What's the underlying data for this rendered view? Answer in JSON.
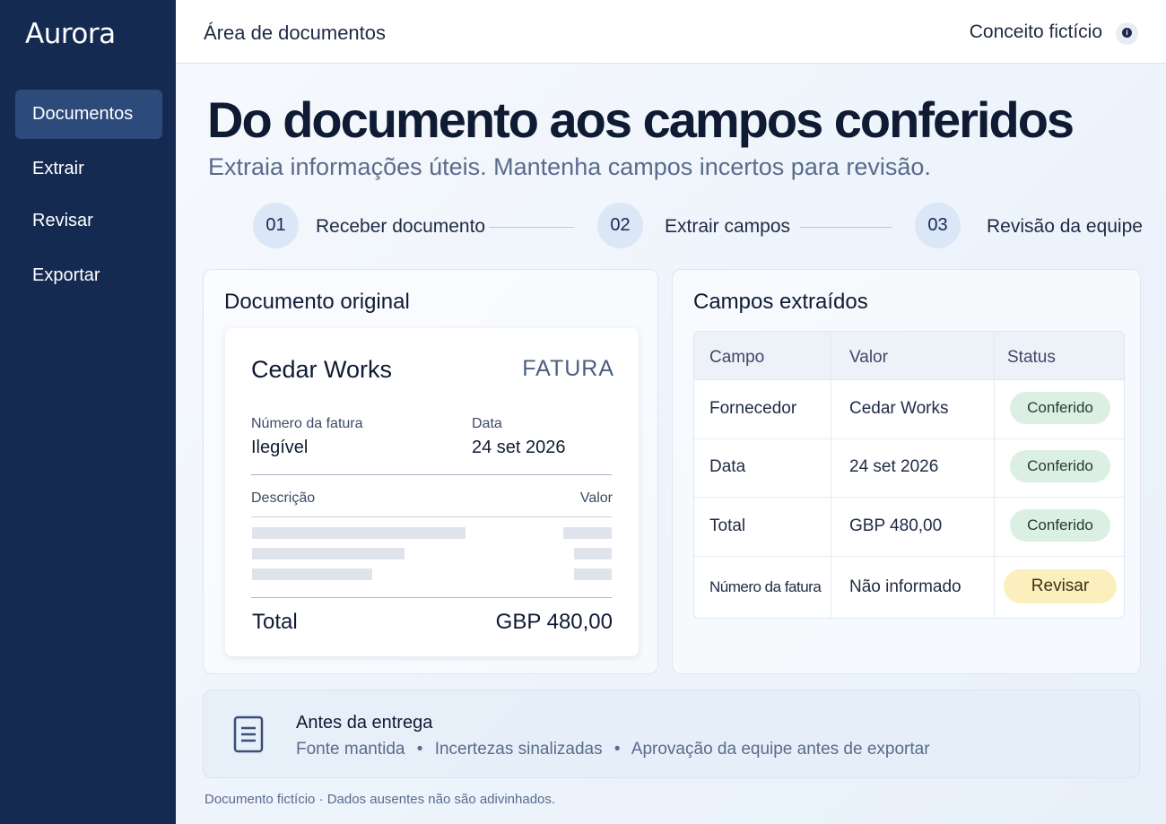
{
  "sidebar": {
    "brand": "Aurora",
    "items": [
      {
        "label": "Documentos",
        "active": true
      },
      {
        "label": "Extrair",
        "active": false
      },
      {
        "label": "Revisar",
        "active": false
      },
      {
        "label": "Exportar",
        "active": false
      }
    ]
  },
  "topbar": {
    "title": "Área de documentos",
    "concept_label": "Conceito fictício",
    "info_icon": "info-icon"
  },
  "hero": {
    "title": "Do documento aos campos conferidos",
    "subtitle": "Extraia informações úteis. Mantenha campos incertos para revisão."
  },
  "steps": [
    {
      "number": "01",
      "label": "Receber documento"
    },
    {
      "number": "02",
      "label": "Extrair campos"
    },
    {
      "number": "03",
      "label": "Revisão da equipe"
    }
  ],
  "original_document": {
    "panel_title": "Documento original",
    "company": "Cedar Works",
    "doc_type": "FATURA",
    "invoice_number_label": "Número da fatura",
    "invoice_number_value": "Ilegível",
    "date_label": "Data",
    "date_value": "24 set 2026",
    "description_label": "Descrição",
    "amount_label": "Valor",
    "total_label": "Total",
    "total_value": "GBP 480,00"
  },
  "extracted_fields": {
    "panel_title": "Campos extraídos",
    "columns": [
      "Campo",
      "Valor",
      "Status"
    ],
    "rows": [
      {
        "field": "Fornecedor",
        "value": "Cedar Works",
        "status": "Conferido",
        "status_type": "ok"
      },
      {
        "field": "Data",
        "value": "24 set 2026",
        "status": "Conferido",
        "status_type": "ok"
      },
      {
        "field": "Total",
        "value": "GBP 480,00",
        "status": "Conferido",
        "status_type": "ok"
      },
      {
        "field": "Número da fatura",
        "value": "Não informado",
        "status": "Revisar",
        "status_type": "warn"
      }
    ]
  },
  "before_delivery": {
    "icon": "document-icon",
    "title": "Antes da entrega",
    "items": [
      "Fonte mantida",
      "Incertezas sinalizadas",
      "Aprovação da equipe antes de exportar"
    ],
    "separator": "•"
  },
  "footnote": "Documento fictício · Dados ausentes não são adivinhados.",
  "colors": {
    "sidebar_bg": "#152a51",
    "sidebar_active": "#2c4a7a",
    "badge_ok": "#dcefe3",
    "badge_warn": "#fbefbe"
  }
}
